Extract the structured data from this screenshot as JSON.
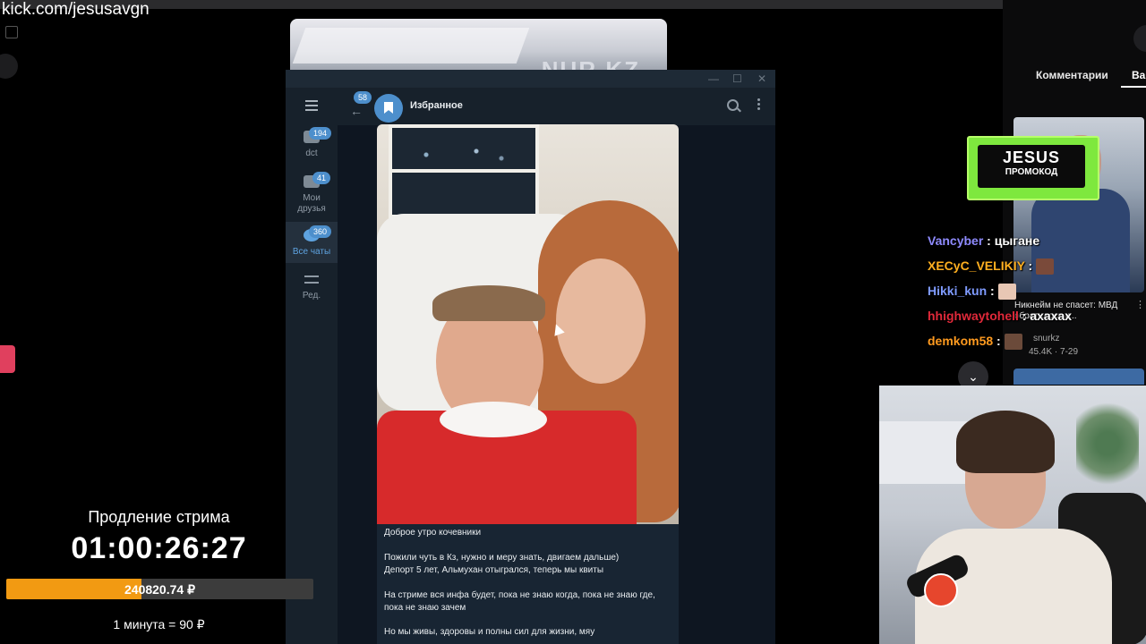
{
  "stream_url": "kick.com/jesusavgn",
  "telegram": {
    "chat_title": "Избранное",
    "back_badge": "58",
    "folders": [
      {
        "label": "dct",
        "badge": "194"
      },
      {
        "label": "Мои друзья",
        "badge": "41"
      },
      {
        "label": "Все чаты",
        "badge": "360"
      },
      {
        "label": "Ред.",
        "badge": ""
      }
    ],
    "caption_lines": [
      "Доброе утро кочевники",
      "Пожили чуть в Кз, нужно и меру знать, двигаем дальше)",
      "Депорт 5 лет, Альмухан отыгрался, теперь мы квиты",
      "На стриме вся инфа будет, пока не знаю когда, пока не знаю где,",
      "пока не знаю зачем",
      "Но мы живы, здоровы и полны сил для жизни, мяу"
    ]
  },
  "sidebar_right": {
    "tab_comments": "Комментарии",
    "tab_other": "Ва",
    "video_title": "Никнейм не спасет: МВД обратилось к...",
    "video_channel": "snurkz",
    "video_meta": "45.4K · 7-29"
  },
  "promo": {
    "title": "JESUS",
    "subtitle": "ПРОМОКОД"
  },
  "chat": [
    {
      "user": "Vancyber",
      "color": "#8f8bff",
      "msg": "цыгане"
    },
    {
      "user": "XECyC_VELIKIY",
      "color": "#ffb020",
      "msg": ""
    },
    {
      "user": "Hikki_kun",
      "color": "#7f9bff",
      "msg": ""
    },
    {
      "user": "hhighwaytohell",
      "color": "#e0293a",
      "msg": "ахахах"
    },
    {
      "user": "demkom58",
      "color": "#ff9a1f",
      "msg": ""
    }
  ],
  "extension": {
    "title": "Продление стрима",
    "timer": "01:00:26:27",
    "amount": "240820.74 ₽",
    "progress": 0.44,
    "rate": "1 минута = 90 ₽"
  },
  "colors": {
    "telegram_bg": "#17212b",
    "telegram_accent": "#4d8fcc",
    "progress_fill": "#f29a12",
    "promo_green": "#7ee83e"
  }
}
